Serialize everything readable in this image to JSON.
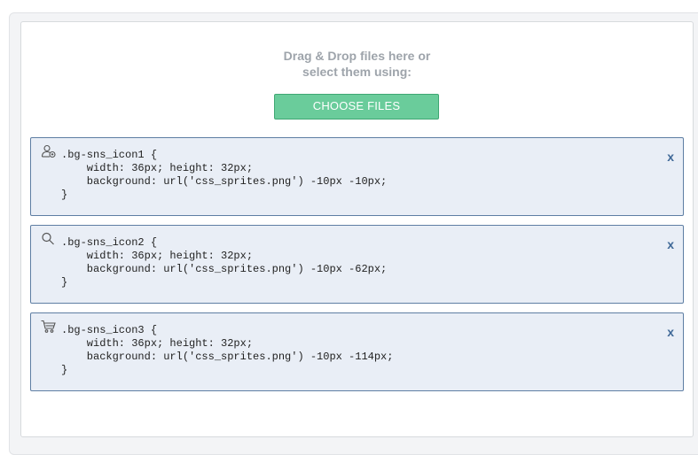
{
  "dropzone": {
    "line1": "Drag & Drop files here or",
    "line2": "select them using:",
    "button_label": "CHOOSE FILES"
  },
  "files": [
    {
      "icon": "user-icon",
      "code": ".bg-sns_icon1 {\n    width: 36px; height: 32px;\n    background: url('css_sprites.png') -10px -10px;\n}",
      "remove_label": "x"
    },
    {
      "icon": "search-icon",
      "code": ".bg-sns_icon2 {\n    width: 36px; height: 32px;\n    background: url('css_sprites.png') -10px -62px;\n}",
      "remove_label": "x"
    },
    {
      "icon": "cart-icon",
      "code": ".bg-sns_icon3 {\n    width: 36px; height: 32px;\n    background: url('css_sprites.png') -10px -114px;\n}",
      "remove_label": "x"
    }
  ]
}
